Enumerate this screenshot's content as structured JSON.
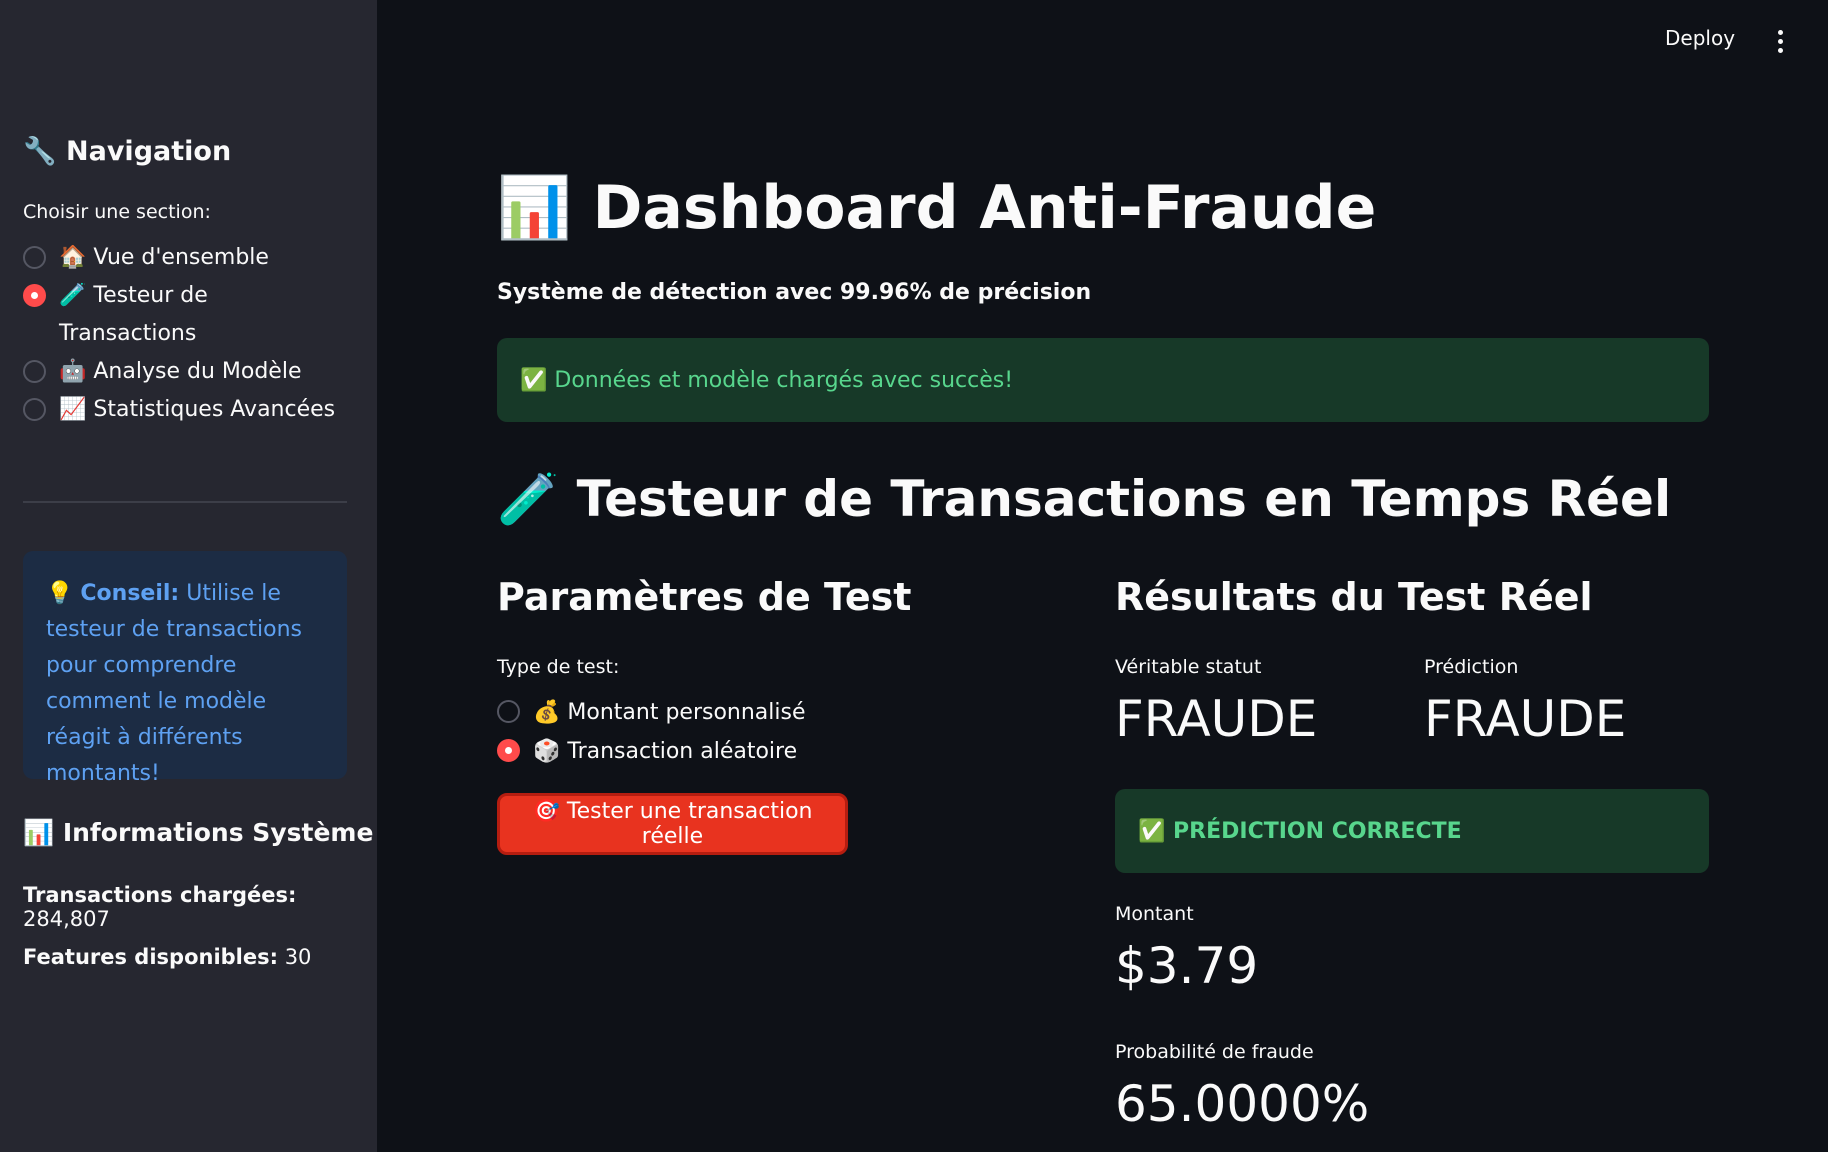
{
  "header": {
    "deploy_label": "Deploy",
    "menu_icon": "kebab-menu-icon"
  },
  "sidebar": {
    "title": "🔧 Navigation",
    "section_label": "Choisir une section:",
    "items": [
      {
        "label": "🏠 Vue d'ensemble",
        "selected": false
      },
      {
        "label": "🧪 Testeur de Transactions",
        "selected": true
      },
      {
        "label": "🤖 Analyse du Modèle",
        "selected": false
      },
      {
        "label": "📈 Statistiques Avancées",
        "selected": false
      }
    ],
    "tip": {
      "prefix": "💡 ",
      "strong": "Conseil:",
      "text": " Utilise le testeur de transactions pour comprendre comment le modèle réagit à différents montants!"
    },
    "system": {
      "title": "📊 Informations Système",
      "transactions_key": "Transactions chargées:",
      "transactions_value": " 284,807",
      "features_key": "Features disponibles:",
      "features_value": " 30"
    }
  },
  "main": {
    "title": "📊 Dashboard Anti-Fraude",
    "subtitle": "Système de détection avec 99.96% de précision",
    "success_message": "✅ Données et modèle chargés avec succès!",
    "section_title": "🧪 Testeur de Transactions en Temps Réel",
    "params": {
      "title": "Paramètres de Test",
      "type_label": "Type de test:",
      "options": [
        {
          "label": "💰 Montant personnalisé",
          "selected": false
        },
        {
          "label": "🎲 Transaction aléatoire",
          "selected": true
        }
      ],
      "button_label": "🎯 Tester une transaction réelle"
    },
    "results": {
      "title": "Résultats du Test Réel",
      "true_status_label": "Véritable statut",
      "true_status_value": "FRAUDE",
      "prediction_label": "Prédiction",
      "prediction_value": "FRAUDE",
      "verdict": "✅ PRÉDICTION CORRECTE",
      "amount_label": "Montant",
      "amount_value": "$3.79",
      "probability_label": "Probabilité de fraude",
      "probability_value": "65.0000%"
    }
  },
  "colors": {
    "background": "#0e1117",
    "sidebar": "#262730",
    "accent": "#ff4b4b",
    "success_bg": "#173928",
    "success_text": "#58d68d",
    "info_bg": "#1c2c44",
    "info_text": "#5ea1f2",
    "button": "#e8331f"
  }
}
